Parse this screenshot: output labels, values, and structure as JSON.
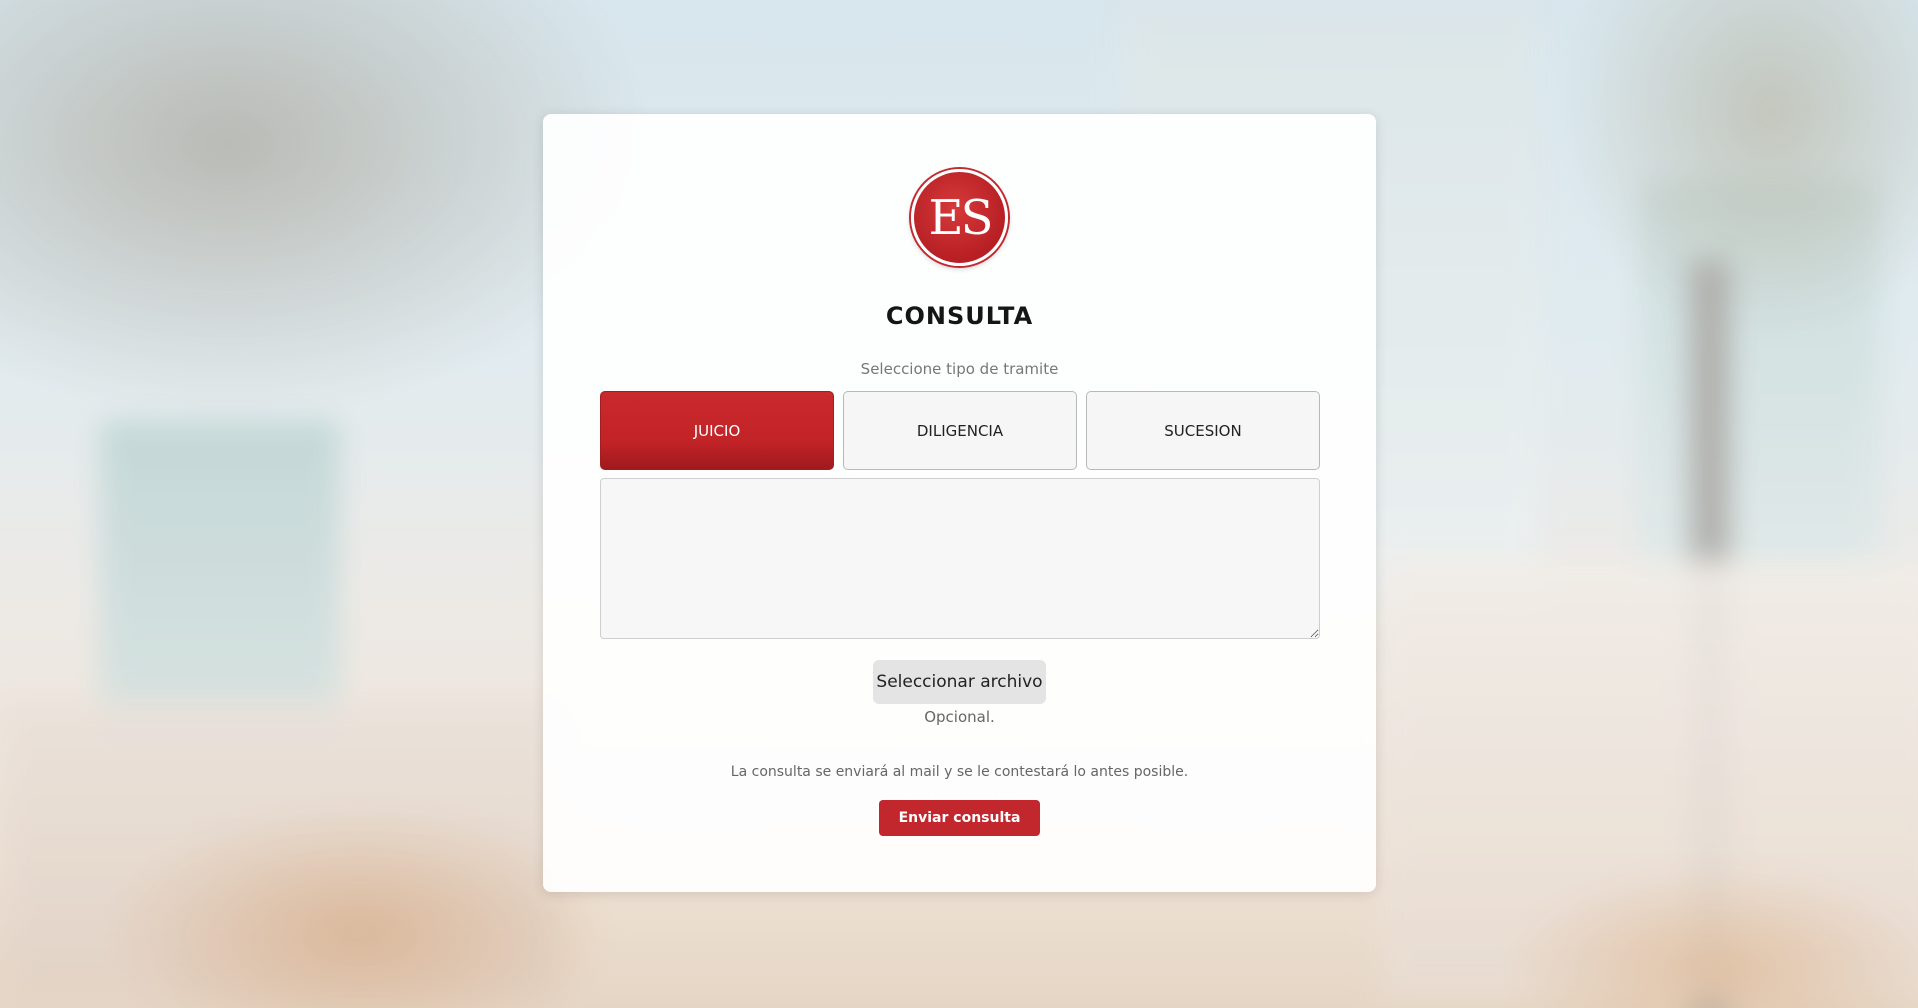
{
  "brand": {
    "logo_text": "ES",
    "accent_color": "#c1272d"
  },
  "form": {
    "title": "CONSULTA",
    "subtitle": "Seleccione tipo de tramite",
    "types": [
      {
        "label": "JUICIO",
        "selected": true
      },
      {
        "label": "DILIGENCIA",
        "selected": false
      },
      {
        "label": "SUCESION",
        "selected": false
      }
    ],
    "message_value": "",
    "file_button_label": "Seleccionar archivo",
    "file_hint": "Opcional.",
    "notice": "La consulta se enviará al mail y se le contestará lo antes posible.",
    "submit_label": "Enviar consulta"
  }
}
